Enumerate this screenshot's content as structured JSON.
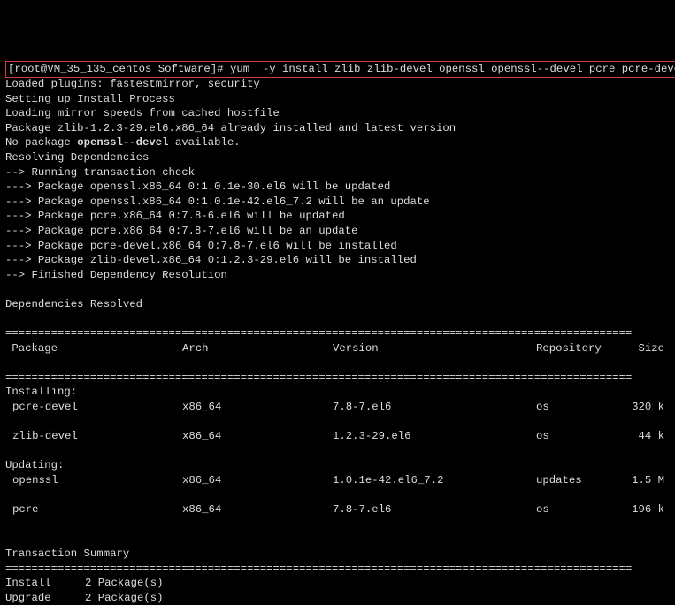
{
  "prompt": {
    "user": "root",
    "host": "VM_35_135_centos",
    "cwd": "Software",
    "command": "yum  -y install zlib zlib-devel openssl openssl--devel pcre pcre-devel"
  },
  "output": {
    "plugins": "Loaded plugins: fastestmirror, security",
    "setup": "Setting up Install Process",
    "mirror": "Loading mirror speeds from cached hostfile",
    "zlib_installed": "Package zlib-1.2.3-29.el6.x86_64 already installed and latest version",
    "no_pkg_pre": "No package ",
    "no_pkg_name": "openssl--devel",
    "no_pkg_post": " available.",
    "resolving": "Resolving Dependencies",
    "run_check": "--> Running transaction check",
    "dep1": "---> Package openssl.x86_64 0:1.0.1e-30.el6 will be updated",
    "dep2": "---> Package openssl.x86_64 0:1.0.1e-42.el6_7.2 will be an update",
    "dep3": "---> Package pcre.x86_64 0:7.8-6.el6 will be updated",
    "dep4": "---> Package pcre.x86_64 0:7.8-7.el6 will be an update",
    "dep5": "---> Package pcre-devel.x86_64 0:7.8-7.el6 will be installed",
    "dep6": "---> Package zlib-devel.x86_64 0:1.2.3-29.el6 will be installed",
    "finished": "--> Finished Dependency Resolution",
    "deps_resolved": "Dependencies Resolved"
  },
  "table": {
    "hrule1": "================================================================================================",
    "hrule2": "================================================================================================",
    "hrule3": "================================================================================================",
    "header": {
      "pkg": " Package",
      "arch": "Arch",
      "ver": "Version",
      "repo": "Repository",
      "size": "Size"
    },
    "installing_label": "Installing:",
    "updating_label": "Updating:",
    "rows": [
      {
        "pkg": "pcre-devel",
        "arch": "x86_64",
        "ver": "7.8-7.el6",
        "repo": "os",
        "size": "320 k"
      },
      {
        "pkg": "zlib-devel",
        "arch": "x86_64",
        "ver": "1.2.3-29.el6",
        "repo": "os",
        "size": "44 k"
      },
      {
        "pkg": "openssl",
        "arch": "x86_64",
        "ver": "1.0.1e-42.el6_7.2",
        "repo": "updates",
        "size": "1.5 M"
      },
      {
        "pkg": "pcre",
        "arch": "x86_64",
        "ver": "7.8-7.el6",
        "repo": "os",
        "size": "196 k"
      }
    ]
  },
  "summary": {
    "title": "Transaction Summary",
    "install_lbl": "Install",
    "install_val": "2 Package(s)",
    "upgrade_lbl": "Upgrade",
    "upgrade_val": "2 Package(s)"
  }
}
